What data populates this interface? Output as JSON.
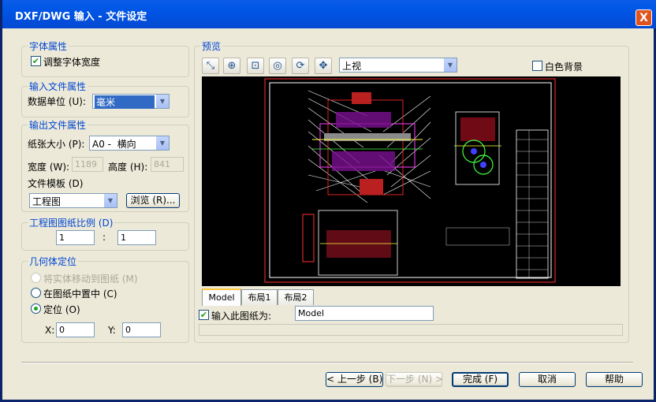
{
  "window": {
    "title": "DXF/DWG 输入 - 文件设定",
    "close_glyph": "X"
  },
  "font_group": {
    "title": "字体属性",
    "adjust_font_width": {
      "label": "调整字体宽度",
      "checked": true
    }
  },
  "input_group": {
    "title": "输入文件属性",
    "data_unit_label": "数据单位 (U):",
    "data_unit_value": "毫米"
  },
  "output_group": {
    "title": "输出文件属性",
    "paper_size_label": "纸张大小 (P):",
    "paper_size_value": "A0 -  横向",
    "width_label": "宽度 (W):",
    "width_value": "1189",
    "height_label": "高度 (H):",
    "height_value": "841",
    "template_label": "文件模板 (D)",
    "template_value": "工程图",
    "browse_label": "浏览 (R)..."
  },
  "scale_group": {
    "title": "工程图图纸比例 (D)",
    "left_value": "1",
    "sep": ":",
    "right_value": "1"
  },
  "geom_group": {
    "title": "几何体定位",
    "opt_move": "将实体移动到图纸 (M)",
    "opt_center": "在图纸中置中 (C)",
    "opt_position": "定位 (O)",
    "selected": "opt_position",
    "x_label": "X:",
    "x_value": "0",
    "y_label": "Y:",
    "y_value": "0"
  },
  "preview": {
    "title": "预览",
    "toolbar_icons": [
      "pan-zoom-icon",
      "zoom-in-icon",
      "zoom-window-icon",
      "zoom-fit-icon",
      "refresh-icon",
      "move-icon"
    ],
    "view_value": "上视",
    "white_bg_label": "白色背景",
    "tabs": [
      "Model",
      "布局1",
      "布局2"
    ],
    "active_tab": "Model",
    "import_sheet_label": "输入此图纸为:",
    "import_sheet_value": "Model"
  },
  "buttons": {
    "prev": "< 上一步 (B)",
    "next": "下一步 (N) >",
    "finish": "完成 (F)",
    "cancel": "取消",
    "help": "帮助"
  },
  "colors": {
    "title_bar": "#0055e5",
    "group_title": "#0046d5",
    "drawing_bg": "#000000",
    "drawing_border": "#ff0000"
  }
}
